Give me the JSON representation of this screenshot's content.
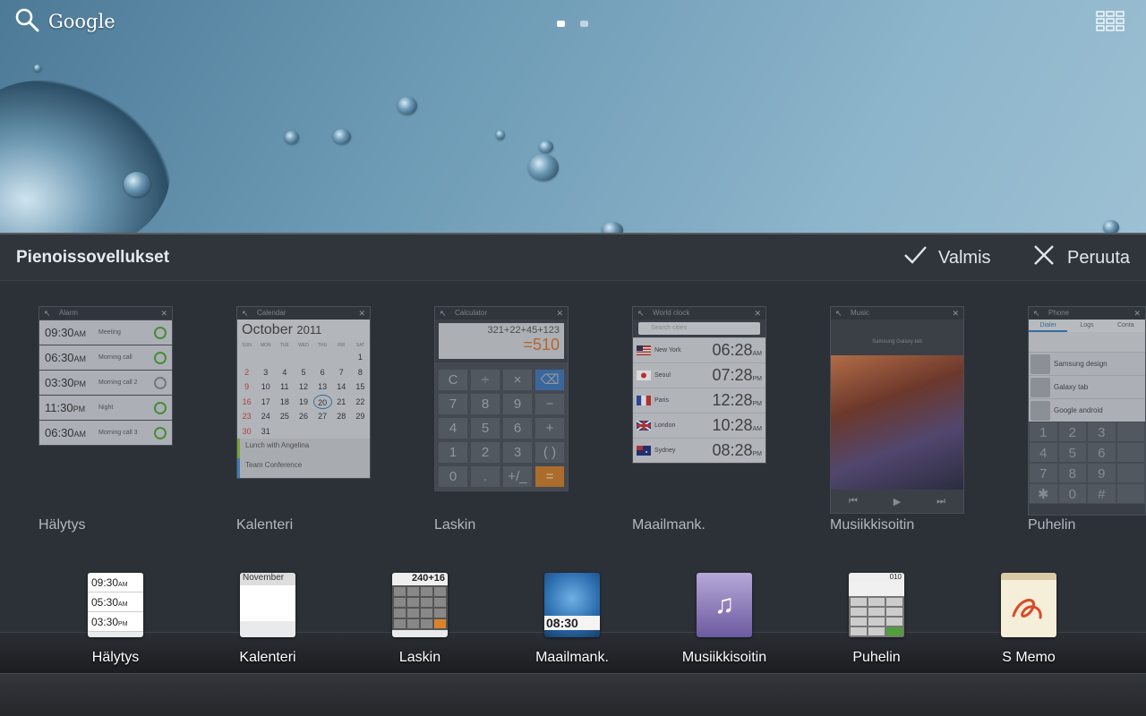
{
  "wallpaper": {
    "search_label": "Google"
  },
  "panel": {
    "title": "Pienoissovellukset",
    "done_label": "Valmis",
    "cancel_label": "Peruuta"
  },
  "widgets": [
    {
      "label": "Hälytys",
      "preview": {
        "header": "Alarm",
        "rows": [
          {
            "time": "09:30",
            "ampm": "AM",
            "name": "Meeting"
          },
          {
            "time": "06:30",
            "ampm": "AM",
            "name": "Morning call"
          },
          {
            "time": "03:30",
            "ampm": "PM",
            "name": "Morning call 2"
          },
          {
            "time": "11:30",
            "ampm": "PM",
            "name": "Night"
          },
          {
            "time": "06:30",
            "ampm": "AM",
            "name": "Morning call 3"
          }
        ]
      }
    },
    {
      "label": "Kalenteri",
      "preview": {
        "header": "Calendar",
        "month": "October",
        "year": "2011",
        "weekdays": [
          "SUN",
          "MON",
          "TUE",
          "WED",
          "THU",
          "FRI",
          "SAT"
        ],
        "days": [
          "",
          "",
          "",
          "",
          "",
          "",
          "1",
          "2",
          "3",
          "4",
          "5",
          "6",
          "7",
          "8",
          "9",
          "10",
          "11",
          "12",
          "13",
          "14",
          "15",
          "16",
          "17",
          "18",
          "19",
          "20",
          "21",
          "22",
          "23",
          "24",
          "25",
          "26",
          "27",
          "28",
          "29",
          "30",
          "31",
          "",
          "",
          "",
          "",
          ""
        ],
        "event1": "Lunch with Angelina",
        "event2": "Team Conference"
      }
    },
    {
      "label": "Laskin",
      "preview": {
        "header": "Calculator",
        "expression": "321+22+45+123",
        "result": "=510",
        "keys": [
          "C",
          "÷",
          "×",
          "⌫",
          "7",
          "8",
          "9",
          "−",
          "4",
          "5",
          "6",
          "+",
          "1",
          "2",
          "3",
          "( )",
          "0",
          ".",
          "+/_",
          "="
        ]
      }
    },
    {
      "label": "Maailmank.",
      "preview": {
        "header": "World clock",
        "search_placeholder": "Search cities",
        "rows": [
          {
            "city": "New York",
            "time": "06:28",
            "ampm": "AM"
          },
          {
            "city": "Seoul",
            "time": "07:28",
            "ampm": "PM"
          },
          {
            "city": "Paris",
            "time": "12:28",
            "ampm": "PM"
          },
          {
            "city": "London",
            "time": "10:28",
            "ampm": "AM"
          },
          {
            "city": "Sydney",
            "time": "08:28",
            "ampm": "PM"
          }
        ]
      }
    },
    {
      "label": "Musiikkisoitin",
      "preview": {
        "header": "Music",
        "track": "Samsung Galaxy tab"
      }
    },
    {
      "label": "Puhelin",
      "preview": {
        "header": "Phone",
        "tabs": [
          "Dialer",
          "Logs",
          "Conta"
        ],
        "contacts": [
          "Samsung design",
          "Galaxy tab",
          "Google android"
        ],
        "keys": [
          "1",
          "2",
          "3",
          "",
          "4",
          "5",
          "6",
          "",
          "7",
          "8",
          "9",
          "",
          "✱",
          "0",
          "#",
          ""
        ]
      }
    }
  ],
  "dock": [
    {
      "label": "Hälytys",
      "icon": "alarm-icon",
      "lines": [
        {
          "time": "09:30",
          "ampm": "AM"
        },
        {
          "time": "05:30",
          "ampm": "AM"
        },
        {
          "time": "03:30",
          "ampm": "PM"
        }
      ]
    },
    {
      "label": "Kalenteri",
      "icon": "calendar-icon",
      "month": "November"
    },
    {
      "label": "Laskin",
      "icon": "calculator-icon",
      "expression": "240+16"
    },
    {
      "label": "Maailmank.",
      "icon": "world-clock-icon",
      "time": "08:30"
    },
    {
      "label": "Musiikkisoitin",
      "icon": "music-icon"
    },
    {
      "label": "Puhelin",
      "icon": "phone-icon",
      "number": "010"
    },
    {
      "label": "S Memo",
      "icon": "memo-icon"
    }
  ],
  "colors": {
    "panel": "#2c3037",
    "accent_blue": "#3a78b3",
    "accent_orange": "#d9702a",
    "alarm_green": "#4fa03a"
  }
}
